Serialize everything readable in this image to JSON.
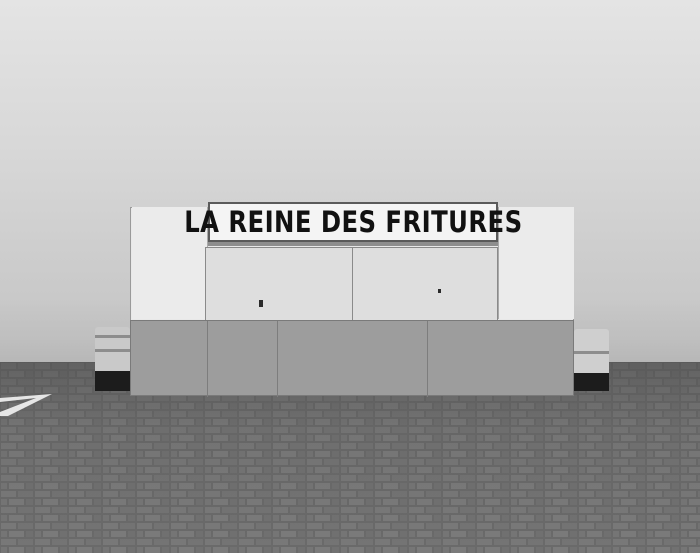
{
  "photo": {
    "tone": "black-and-white",
    "sign_text": "LA REINE DES FRITURES"
  },
  "colors": {
    "sky": "#dcdcdc",
    "kiosk_upper": "#e8e8e8",
    "kiosk_lower": "#9d9d9d",
    "sign_lettering": "#111111",
    "pavement": "#6e6e6e"
  }
}
